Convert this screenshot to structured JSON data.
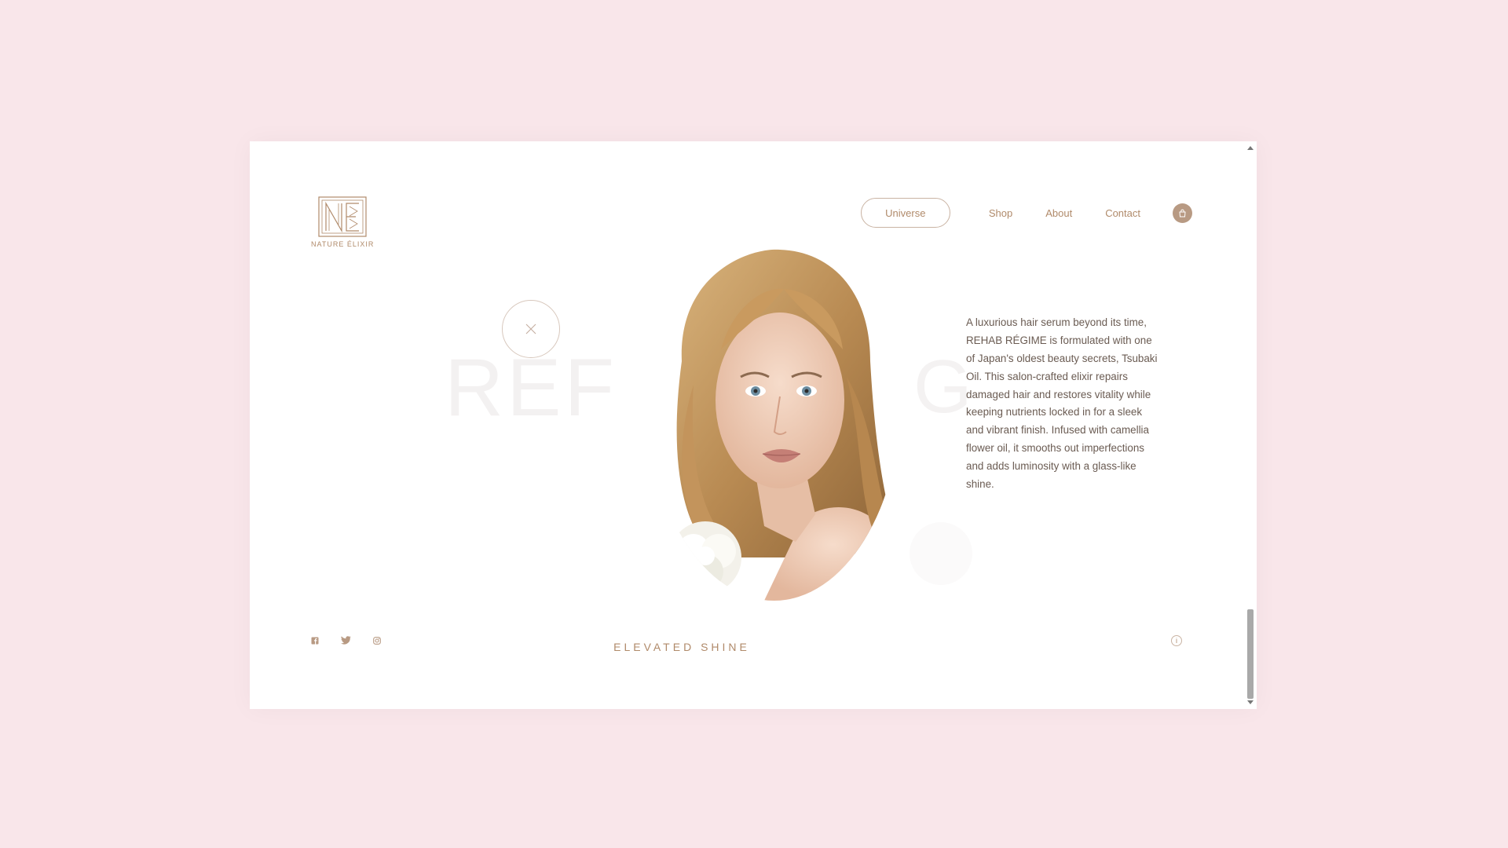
{
  "brand": {
    "name": "NATURE ÉLIXIR"
  },
  "nav": {
    "active": "Universe",
    "links": [
      "Shop",
      "About",
      "Contact"
    ]
  },
  "hero": {
    "ghost_word_start": "REF",
    "ghost_word_end": "G",
    "description": "A luxurious hair serum beyond its time, REHAB RÉGIME is formulated with one of Japan's oldest beauty secrets, Tsubaki Oil. This salon-crafted elixir repairs damaged hair and restores vitality while keeping nutrients locked in for a sleek and vibrant finish. Infused with camellia flower oil, it smooths out imperfections and adds luminosity with a glass-like shine.",
    "tagline": "ELEVATED SHINE"
  },
  "footer": {
    "social_icons": [
      "facebook-icon",
      "twitter-icon",
      "instagram-icon"
    ],
    "info_label": "i"
  },
  "colors": {
    "background": "#f9e6ea",
    "accent": "#b08a6a",
    "text": "#6a5b52"
  }
}
